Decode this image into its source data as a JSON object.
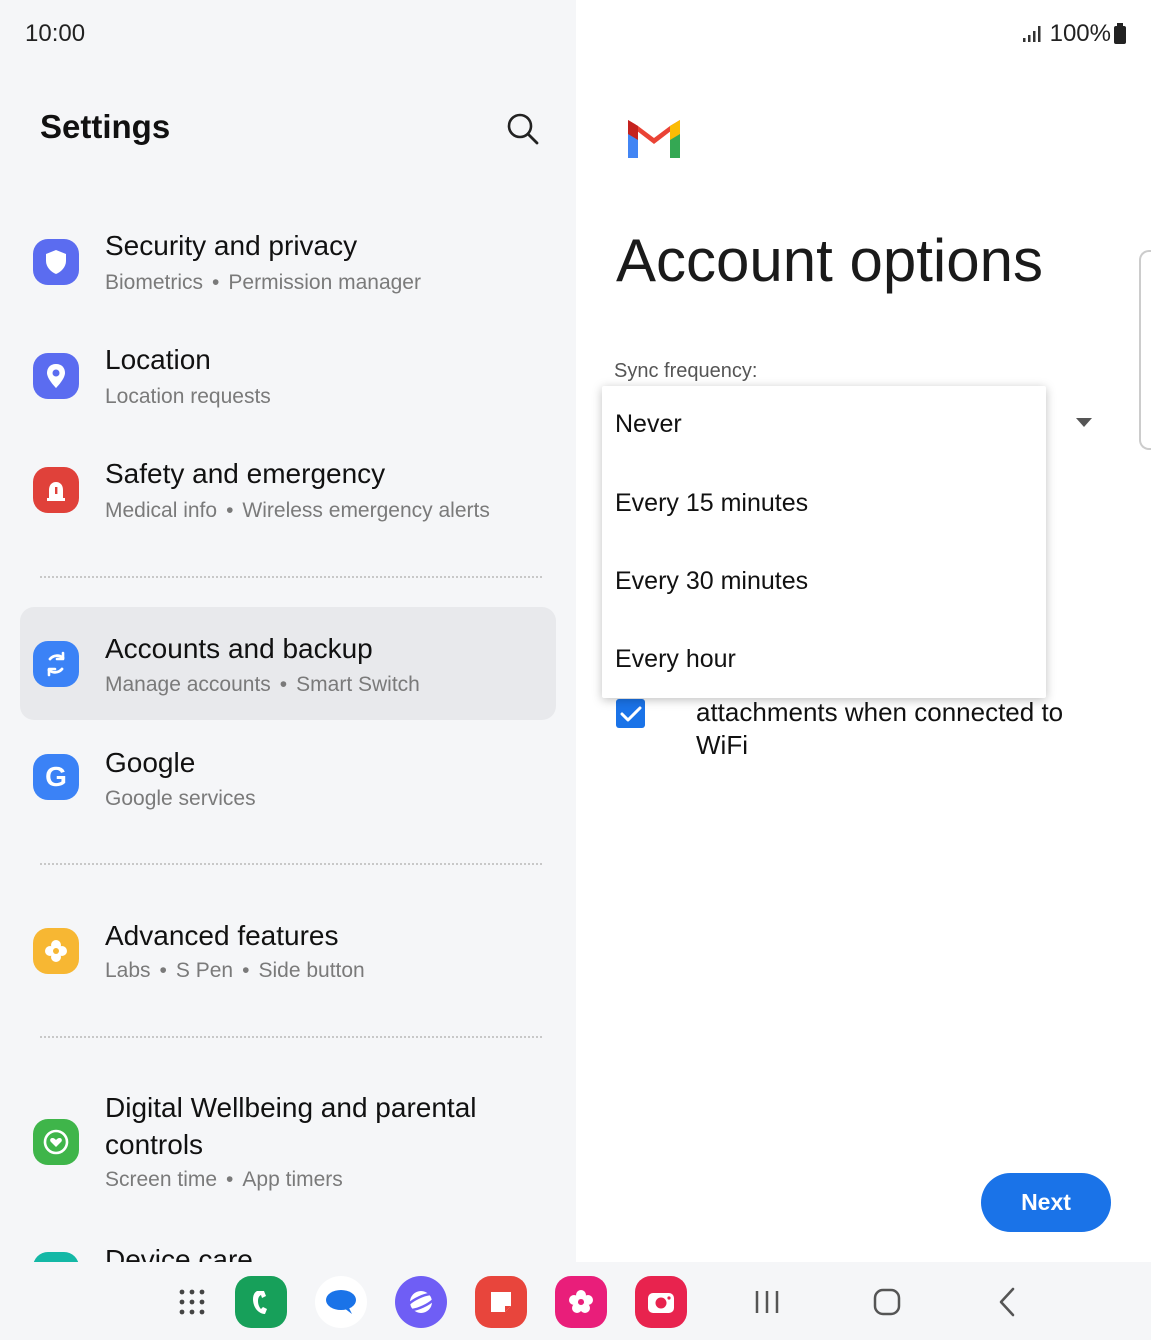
{
  "status_bar": {
    "time": "10:00",
    "battery": "100%"
  },
  "settings": {
    "title": "Settings",
    "items": [
      {
        "title": "Security and privacy",
        "sub": [
          "Biometrics",
          "Permission manager"
        ]
      },
      {
        "title": "Location",
        "sub": [
          "Location requests"
        ]
      },
      {
        "title": "Safety and emergency",
        "sub": [
          "Medical info",
          "Wireless emergency alerts"
        ]
      },
      {
        "title": "Accounts and backup",
        "sub": [
          "Manage accounts",
          "Smart Switch"
        ]
      },
      {
        "title": "Google",
        "sub": [
          "Google services"
        ]
      },
      {
        "title": "Advanced features",
        "sub": [
          "Labs",
          "S Pen",
          "Side button"
        ]
      },
      {
        "title_line1": "Digital Wellbeing and parental",
        "title_line2": "controls",
        "sub": [
          "Screen time",
          "App timers"
        ]
      },
      {
        "title": "Device care"
      }
    ],
    "separator": "•"
  },
  "account_options": {
    "title": "Account options",
    "sync_label": "Sync frequency:",
    "sync_options": [
      "Never",
      "Every 15 minutes",
      "Every 30 minutes",
      "Every hour"
    ],
    "checkbox_text_line1": "attachments when connected to",
    "checkbox_text_line2": "WiFi",
    "checkbox_checked": true,
    "next_label": "Next"
  },
  "colors": {
    "accent": "#1a73e8",
    "security_icon": "#5b6cf0",
    "location_icon": "#5b6cf0",
    "safety_icon": "#e0413a",
    "accounts_icon": "#3b82f6",
    "google_icon": "#3b82f6",
    "advanced_icon": "#f7b733",
    "wellbeing_icon": "#3fb54a"
  },
  "icons": [
    "search-icon",
    "shield-icon",
    "location-pin-icon",
    "siren-icon",
    "sync-icon",
    "google-g-icon",
    "gear-flower-icon",
    "wellbeing-heart-icon",
    "gmail-logo",
    "signal-icon",
    "battery-icon"
  ]
}
